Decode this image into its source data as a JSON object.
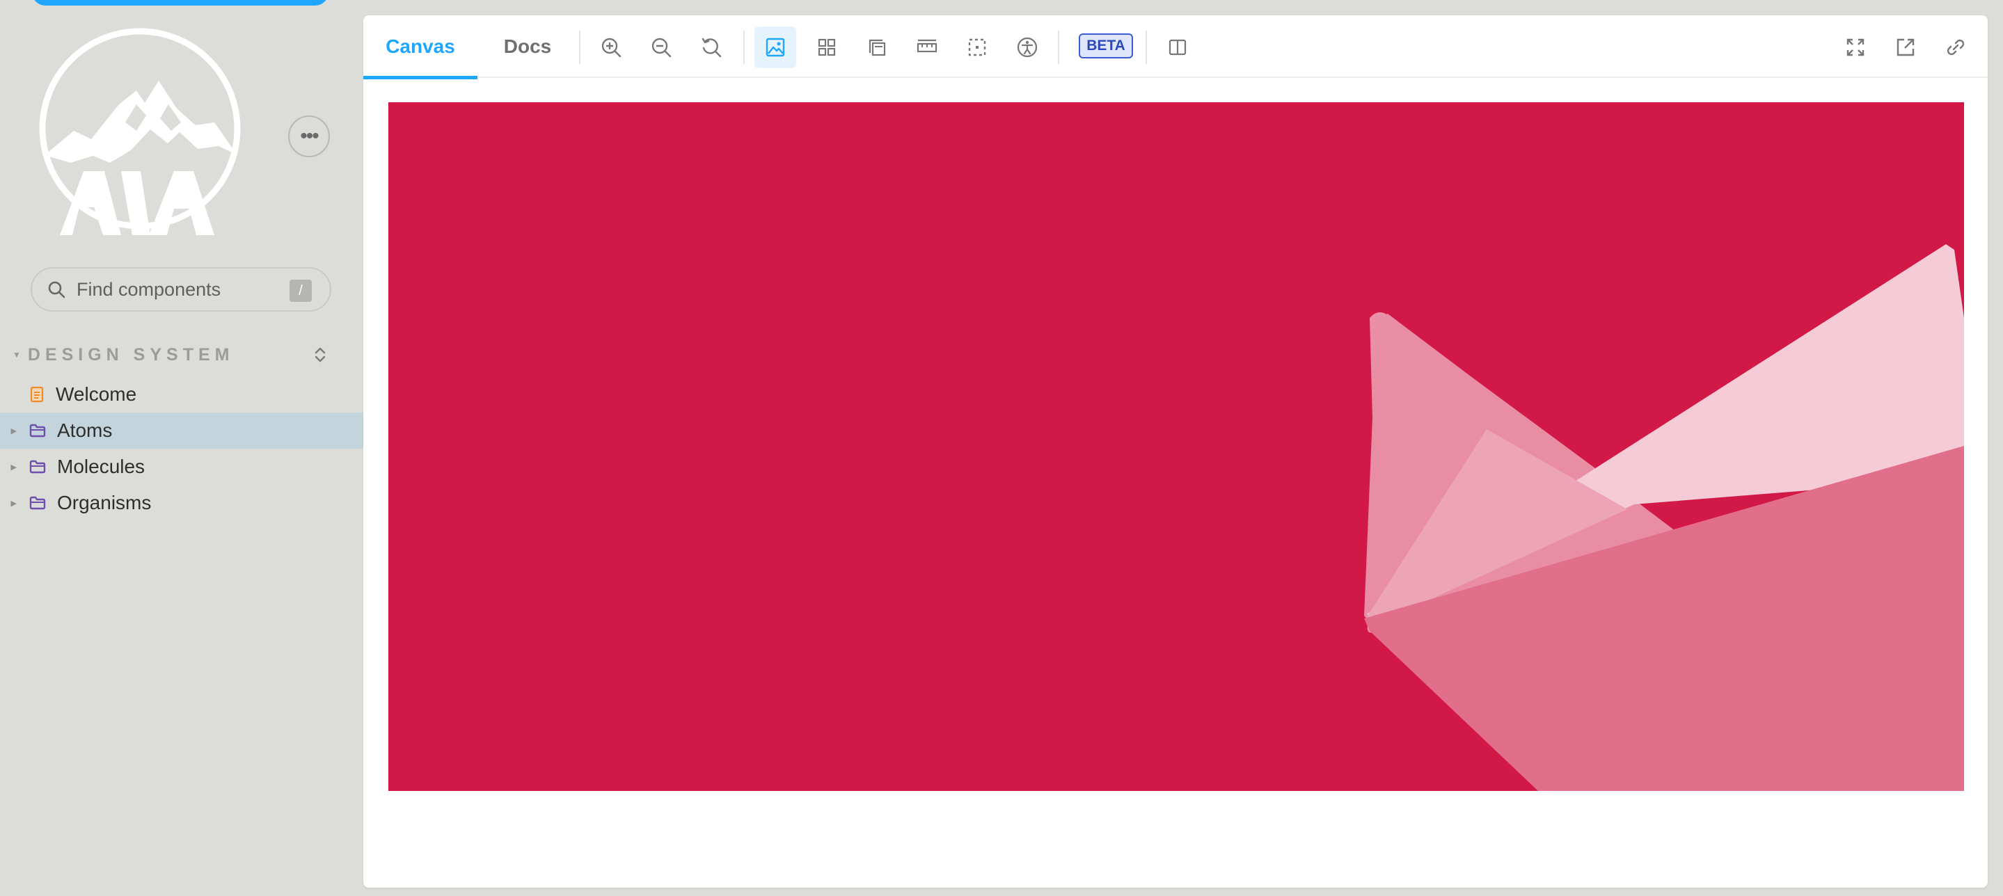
{
  "sidebar": {
    "brand": "AIA",
    "menu_icon": "ellipsis-icon",
    "search": {
      "placeholder": "Find components",
      "shortcut": "/"
    },
    "section": {
      "title": "DESIGN SYSTEM"
    },
    "items": [
      {
        "label": "Welcome",
        "icon": "document-icon",
        "selected": false
      },
      {
        "label": "Atoms",
        "icon": "folder-icon",
        "selected": true
      },
      {
        "label": "Molecules",
        "icon": "folder-icon",
        "selected": false
      },
      {
        "label": "Organisms",
        "icon": "folder-icon",
        "selected": false
      }
    ]
  },
  "toolbar": {
    "tabs": [
      {
        "label": "Canvas",
        "active": true
      },
      {
        "label": "Docs",
        "active": false
      }
    ],
    "tools": [
      "zoom-in-icon",
      "zoom-out-icon",
      "reset-zoom-icon",
      "background-icon",
      "grid-icon",
      "viewport-icon",
      "measure-icon",
      "outline-icon",
      "accessibility-icon"
    ],
    "beta_label": "BETA",
    "right_tools": [
      "fullscreen-icon",
      "open-new-tab-icon",
      "copy-link-icon"
    ]
  },
  "colors": {
    "accent": "#1ea7fd",
    "canvas_bg": "#d21847",
    "sidebar_bg": "#dcdcd8",
    "selected_bg": "#c4d4dc"
  }
}
